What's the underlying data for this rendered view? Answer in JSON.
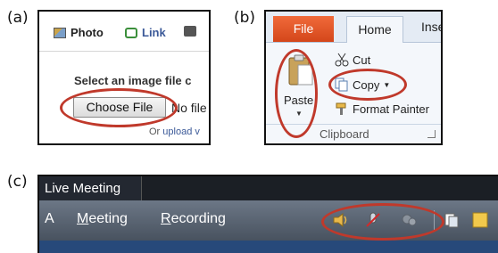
{
  "labels": {
    "a": "(a)",
    "b": "(b)",
    "c": "(c)"
  },
  "panel_a": {
    "tabs": [
      {
        "label": "Photo",
        "icon": "photo-icon"
      },
      {
        "label": "Link",
        "icon": "link-icon"
      },
      {
        "label": "",
        "icon": "video-icon"
      }
    ],
    "prompt": "Select an image file c",
    "choose_button": "Choose File",
    "no_file": "No file",
    "or_text": "Or ",
    "or_link": "upload v"
  },
  "panel_b": {
    "tabs": {
      "file": "File",
      "home": "Home",
      "insert": "Inse"
    },
    "paste_label": "Paste",
    "cut_label": "Cut",
    "copy_label": "Copy",
    "format_painter_label": "Format Painter",
    "group_label": "Clipboard"
  },
  "panel_c": {
    "title": "Live Meeting",
    "menu": {
      "partial": "A",
      "meeting_underline": "M",
      "meeting_rest": "eeting",
      "recording_underline": "R",
      "recording_rest": "ecording"
    },
    "icons": [
      "speaker-icon",
      "mic-muted-icon",
      "webcam-icon",
      "handout-icon",
      "note-icon"
    ]
  },
  "colors": {
    "highlight_ring": "#c0392b",
    "file_tab": "#e0522a",
    "facebook_blue": "#3b5998"
  }
}
